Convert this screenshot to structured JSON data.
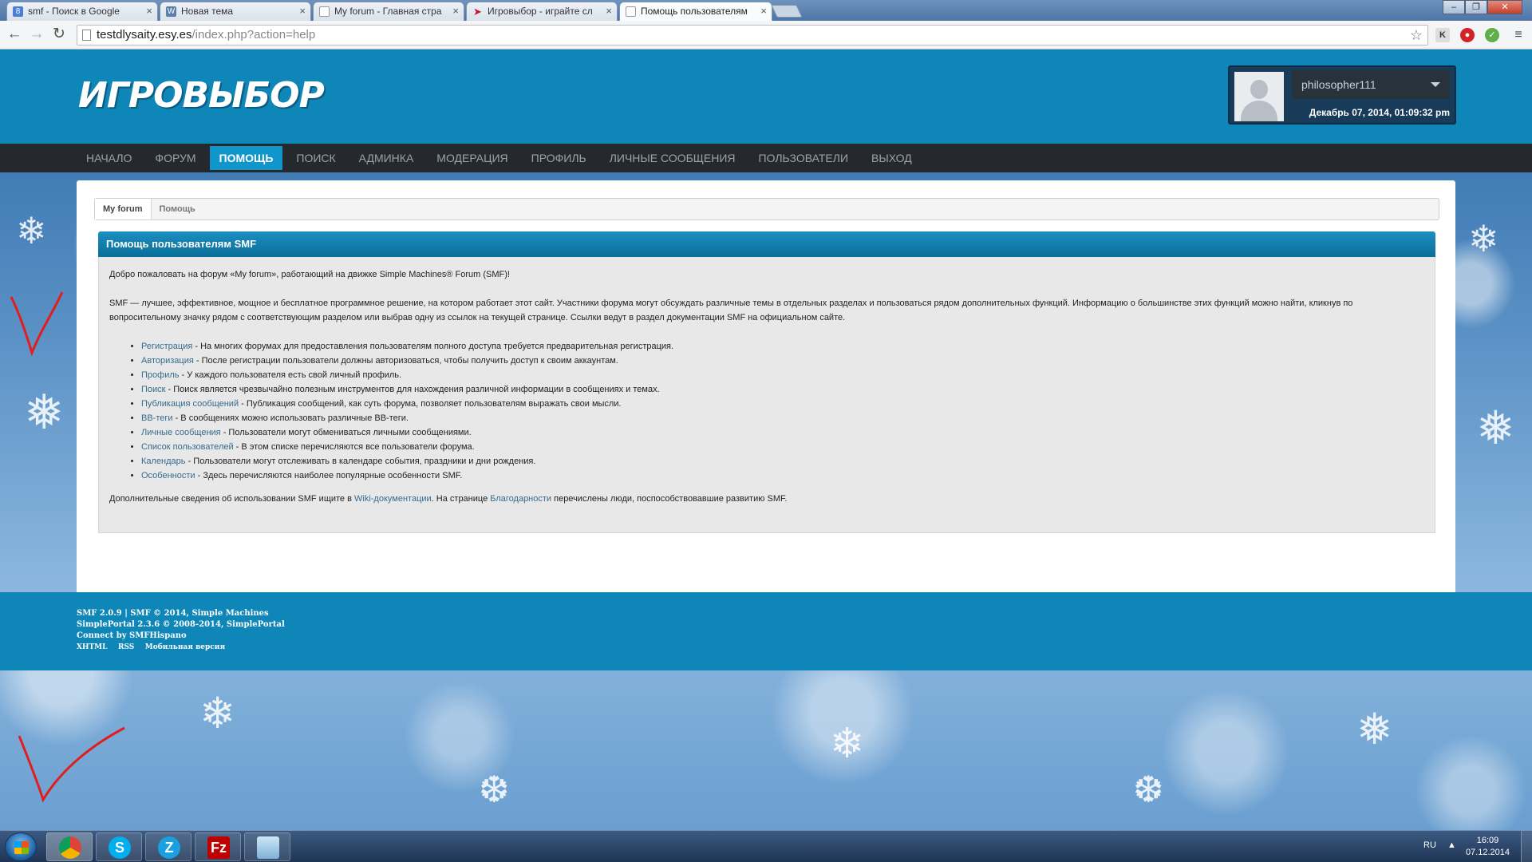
{
  "browser": {
    "tabs": [
      {
        "label": "smf - Поиск в Google",
        "favicon": "8"
      },
      {
        "label": "Новая тема",
        "favicon": "W"
      },
      {
        "label": "My forum - Главная стра",
        "favicon": ""
      },
      {
        "label": "Игровыбор - играйте сл",
        "favicon": ""
      },
      {
        "label": "Помощь пользователям",
        "favicon": ""
      }
    ],
    "url_host": "testdlysaity.esy.es",
    "url_path": "/index.php?action=help"
  },
  "site": {
    "logo_text": "ИГРОВЫБОР",
    "username": "philosopher111",
    "datetime": "Декабрь 07, 2014, 01:09:32 pm",
    "nav": [
      "Начало",
      "Форум",
      "Помощь",
      "Поиск",
      "Админка",
      "Модерация",
      "Профиль",
      "Личные сообщения",
      "Пользователи",
      "Выход"
    ]
  },
  "breadcrumb": [
    "My forum",
    "Помощь"
  ],
  "help": {
    "title": "Помощь пользователям SMF",
    "welcome": "Добро пожаловать на форум «My forum», работающий на движке Simple Machines® Forum (SMF)!",
    "intro": "SMF — лучшее, эффективное, мощное и бесплатное программное решение, на котором работает этот сайт. Участники форума могут обсуждать различные темы в отдельных разделах и пользоваться рядом дополнительных функций. Информацию о большинстве этих функций можно найти, кликнув по вопросительному значку рядом с соответствующим разделом или выбрав одну из ссылок на текущей странице. Ссылки ведут в раздел документации SMF на официальном сайте.",
    "items": [
      {
        "link": "Регистрация",
        "text": " - На многих форумах для предоставления пользователям полного доступа требуется предварительная регистрация."
      },
      {
        "link": "Авторизация",
        "text": " - После регистрации пользователи должны авторизоваться, чтобы получить доступ к своим аккаунтам."
      },
      {
        "link": "Профиль",
        "text": " - У каждого пользователя есть свой личный профиль."
      },
      {
        "link": "Поиск",
        "text": " - Поиск является чрезвычайно полезным инструментов для нахождения различной информации в сообщениях и темах."
      },
      {
        "link": "Публикация сообщений",
        "text": " - Публикация сообщений, как суть форума, позволяет пользователям выражать свои мысли."
      },
      {
        "link": "BB-теги",
        "text": " - В сообщениях можно использовать различные BB-теги."
      },
      {
        "link": "Личные сообщения",
        "text": " - Пользователи могут обмениваться личными сообщениями."
      },
      {
        "link": "Список пользователей",
        "text": " - В этом списке перечисляются все пользователи форума."
      },
      {
        "link": "Календарь",
        "text": " - Пользователи могут отслеживать в календаре события, праздники и дни рождения."
      },
      {
        "link": "Особенности",
        "text": " - Здесь перечисляются наиболее популярные особенности SMF."
      }
    ],
    "more_1": "Дополнительные сведения об использовании SMF ищите в ",
    "more_link1": "Wiki-документации",
    "more_2": ". На странице ",
    "more_link2": "Благодарности",
    "more_3": " перечислены люди, поспособствовавшие развитию SMF."
  },
  "footer": {
    "line1": "SMF 2.0.9 | SMF © 2014, Simple Machines",
    "line2": "SimplePortal 2.3.6 © 2008-2014, SimplePortal",
    "line3": "Connect by SMFHispano",
    "links": [
      "XHTML",
      "RSS",
      "Мобильная версия"
    ]
  },
  "taskbar": {
    "apps": [
      "chrome",
      "skype",
      "zona",
      "filezilla",
      "explorer"
    ],
    "lang": "RU",
    "time": "16:09",
    "date": "07.12.2014"
  },
  "colors": {
    "header": "#0f86b8",
    "nav": "#25292d",
    "nav_active": "#1196cc",
    "link": "#346b8f"
  }
}
